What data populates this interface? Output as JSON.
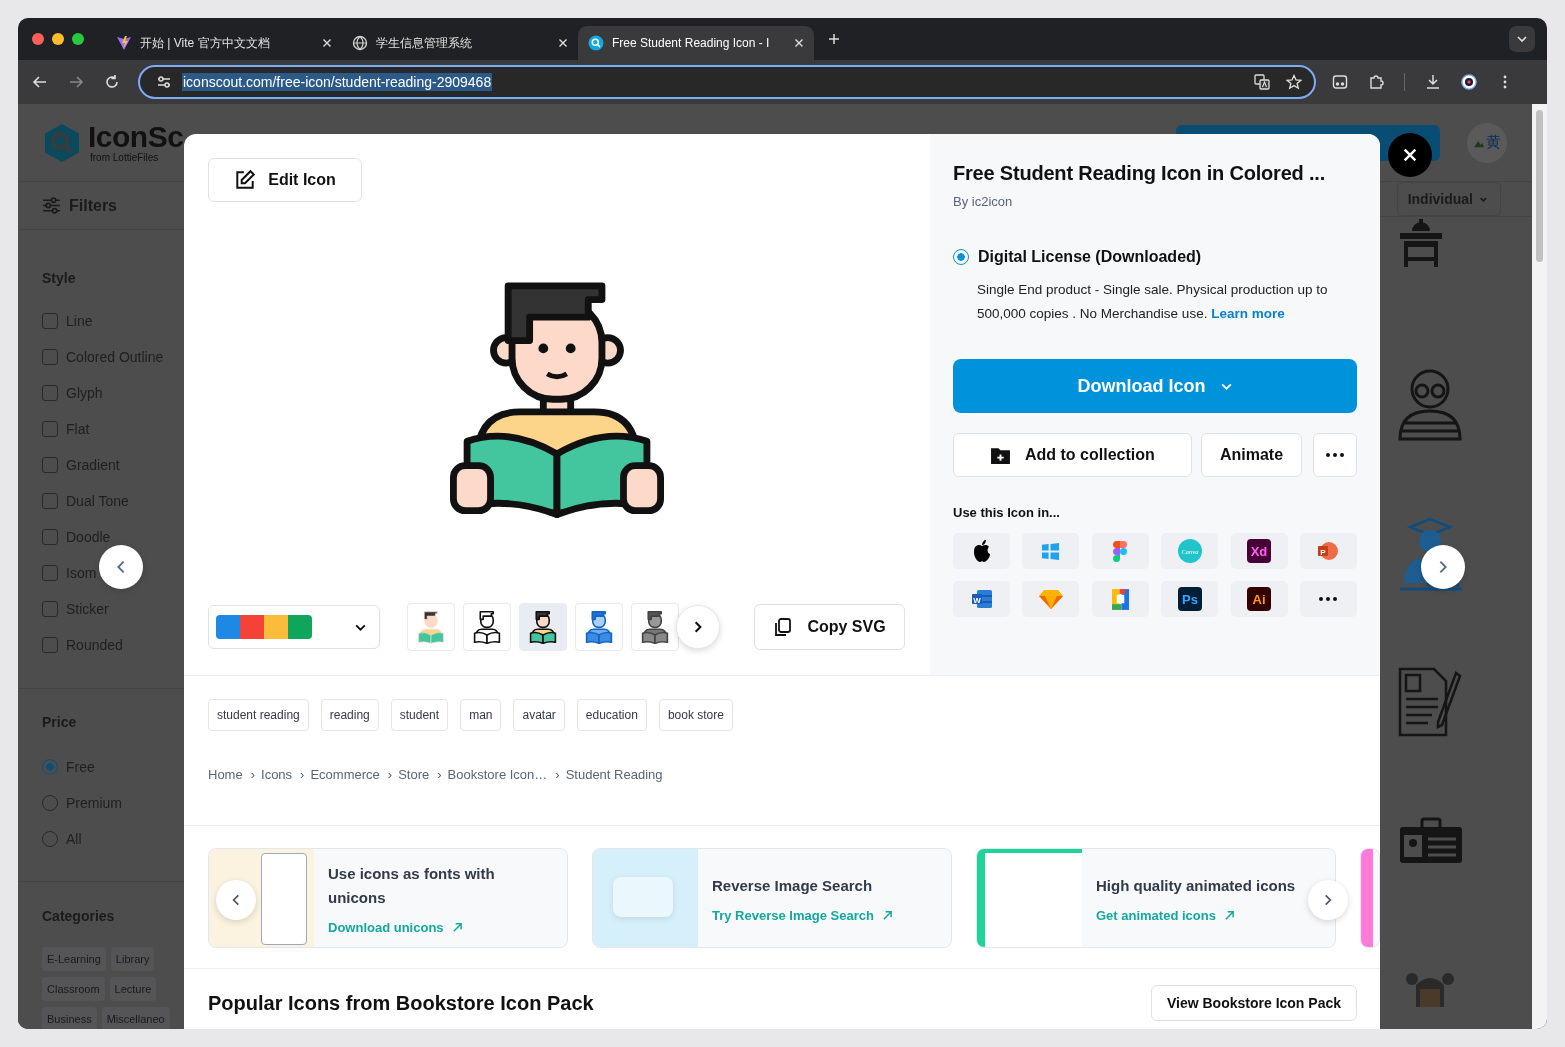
{
  "browser": {
    "tabs": [
      {
        "title": "开始 | Vite 官方中文文档",
        "kind": "vite",
        "selected": false
      },
      {
        "title": "学生信息管理系统",
        "kind": "globe",
        "selected": false
      },
      {
        "title": "Free Student Reading Icon - I",
        "kind": "iconscout",
        "selected": true
      }
    ],
    "url": "iconscout.com/free-icon/student-reading-2909468"
  },
  "site": {
    "logo": "IconSc",
    "logo_sub": "from LottieFiles",
    "avatar_alt": "黄",
    "filters": "Filters",
    "license_select": "Individual",
    "style": {
      "title": "Style",
      "options": [
        {
          "label": "Line",
          "checked": false
        },
        {
          "label": "Colored Outline",
          "checked": false
        },
        {
          "label": "Glyph",
          "checked": false
        },
        {
          "label": "Flat",
          "checked": false
        },
        {
          "label": "Gradient",
          "checked": false
        },
        {
          "label": "Dual Tone",
          "checked": false
        },
        {
          "label": "Doodle",
          "checked": false
        },
        {
          "label": "Isom",
          "checked": false
        },
        {
          "label": "Sticker",
          "checked": false
        },
        {
          "label": "Rounded",
          "checked": false
        }
      ]
    },
    "price": {
      "title": "Price",
      "options": [
        {
          "label": "Free",
          "selected": true
        },
        {
          "label": "Premium",
          "selected": false
        },
        {
          "label": "All",
          "selected": false
        }
      ]
    },
    "categories": {
      "title": "Categories",
      "chips": [
        "E-Learning",
        "Library",
        "Classroom",
        "Lecture",
        "Business",
        "Miscellaneo"
      ]
    },
    "results": [
      {
        "kind": "desk"
      },
      {
        "kind": "glasses"
      },
      {
        "kind": "graduate"
      },
      {
        "kind": "document"
      },
      {
        "kind": "idcard"
      },
      {
        "kind": "girl"
      }
    ]
  },
  "modal": {
    "edit_button": "Edit Icon",
    "palette": {
      "colors": [
        {
          "color": "#1e88e5"
        },
        {
          "color": "#f44336"
        },
        {
          "color": "#fbbc3b"
        },
        {
          "color": "#0fa55a"
        }
      ]
    },
    "variants": [
      {
        "kind": "flat",
        "selected": false
      },
      {
        "kind": "outline",
        "selected": false
      },
      {
        "kind": "colored",
        "selected": true
      },
      {
        "kind": "blue",
        "selected": false
      },
      {
        "kind": "glyph",
        "selected": false
      }
    ],
    "copy_button": "Copy SVG",
    "title": "Free Student Reading Icon in Colored ...",
    "author": "By ic2icon",
    "license": {
      "label": "Digital License (Downloaded)",
      "selected": true,
      "description": "Single End product - Single sale. Physical production up to 500,000 copies . No Merchandise use.",
      "link": "Learn more"
    },
    "download_button": "Download Icon",
    "collection_button": "Add to collection",
    "animate_button": "Animate",
    "use_in_title": "Use this Icon in...",
    "apps": [
      {
        "kind": "apple"
      },
      {
        "kind": "windows"
      },
      {
        "kind": "figma"
      },
      {
        "kind": "canva",
        "label": "Canva"
      },
      {
        "kind": "xd",
        "label": "Xd"
      },
      {
        "kind": "powerpoint",
        "label": "P"
      },
      {
        "kind": "word",
        "label": "W"
      },
      {
        "kind": "sketch"
      },
      {
        "kind": "docs"
      },
      {
        "kind": "ps",
        "label": "Ps"
      },
      {
        "kind": "ai",
        "label": "Ai"
      },
      {
        "kind": "more"
      }
    ],
    "tags": [
      "student reading",
      "reading",
      "student",
      "man",
      "avatar",
      "education",
      "book store"
    ],
    "breadcrumb": {
      "separator": "›",
      "items": [
        "Home",
        "Icons",
        "Ecommerce",
        "Store",
        "Bookstore Icon…",
        "Student Reading"
      ]
    },
    "promos": [
      {
        "kind": "fonts",
        "title": "Use icons as fonts with unicons",
        "link": "Download unicons"
      },
      {
        "kind": "search",
        "title": "Reverse Image Search",
        "link": "Try Reverse Image Search"
      },
      {
        "kind": "animated",
        "title": "High quality animated icons",
        "link": "Get animated icons"
      }
    ],
    "popular": {
      "title": "Popular Icons from Bookstore Icon Pack",
      "button": "View Bookstore Icon Pack"
    }
  }
}
